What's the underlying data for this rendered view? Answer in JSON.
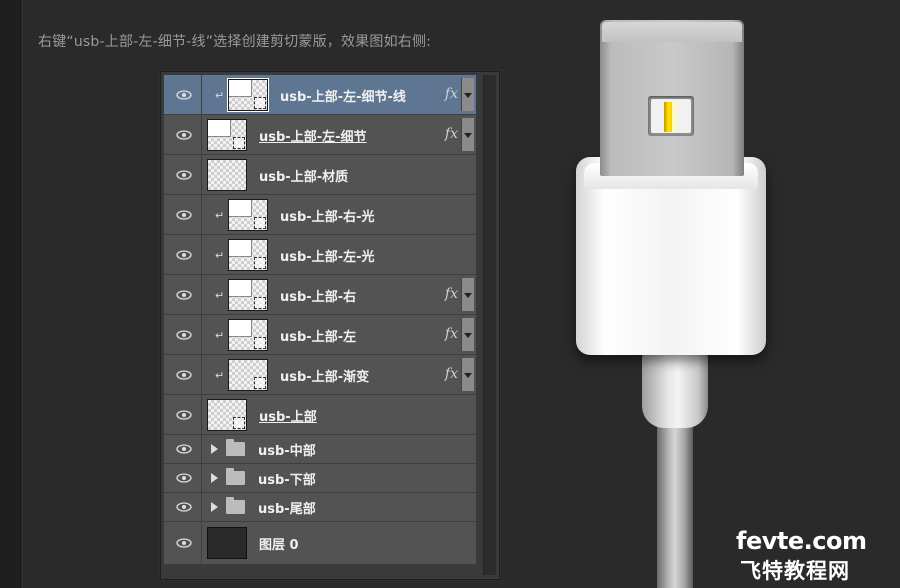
{
  "caption": "右键“usb-上部-左-细节-线”选择创建剪切蒙版，效果图如右侧:",
  "layers": [
    {
      "label": "usb-上部-左-细节-线",
      "fx": "fx"
    },
    {
      "label": "usb-上部-左-细节",
      "fx": "fx"
    },
    {
      "label": "usb-上部-材质"
    },
    {
      "label": "usb-上部-右-光"
    },
    {
      "label": "usb-上部-左-光"
    },
    {
      "label": "usb-上部-右",
      "fx": "fx"
    },
    {
      "label": "usb-上部-左",
      "fx": "fx"
    },
    {
      "label": "usb-上部-渐变",
      "fx": "fx"
    },
    {
      "label": "usb-上部"
    },
    {
      "label": "usb-中部"
    },
    {
      "label": "usb-下部"
    },
    {
      "label": "usb-尾部"
    },
    {
      "label": "图层 0"
    }
  ],
  "watermark": {
    "line1": "fevte.com",
    "line2": "飞特教程网"
  }
}
